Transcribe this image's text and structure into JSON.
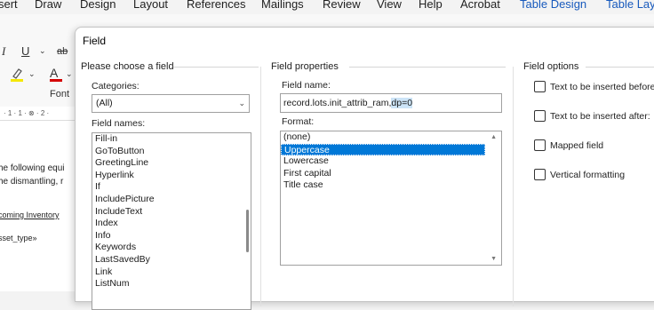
{
  "ribbon": {
    "tabs": [
      {
        "label": "sert",
        "accent": false
      },
      {
        "label": "Draw",
        "accent": false
      },
      {
        "label": "Design",
        "accent": false
      },
      {
        "label": "Layout",
        "accent": false
      },
      {
        "label": "References",
        "accent": false
      },
      {
        "label": "Mailings",
        "accent": false
      },
      {
        "label": "Review",
        "accent": false
      },
      {
        "label": "View",
        "accent": false
      },
      {
        "label": "Help",
        "accent": false
      },
      {
        "label": "Acrobat",
        "accent": false
      },
      {
        "label": "Table Design",
        "accent": true
      },
      {
        "label": "Table Lay",
        "accent": true
      }
    ],
    "font_group_label": "Font",
    "italic": "I",
    "underline": "U",
    "strike": "ab",
    "font_color_glyph": "A",
    "ruler_text": "· 1 · 1 · ⊗ · 2 ·"
  },
  "document": {
    "line1": "he following equi",
    "line2": "he dismantling, r",
    "heading": "coming Inventory",
    "merge_field": "sset_type»"
  },
  "dialog": {
    "title": "Field",
    "choose_panel": {
      "title": "Please choose a field",
      "categories_label": "Categories:",
      "category_value": "(All)",
      "field_names_label": "Field names:",
      "field_names": [
        "Fill-in",
        "GoToButton",
        "GreetingLine",
        "Hyperlink",
        "If",
        "IncludePicture",
        "IncludeText",
        "Index",
        "Info",
        "Keywords",
        "LastSavedBy",
        "Link",
        "ListNum"
      ]
    },
    "properties_panel": {
      "title": "Field properties",
      "field_name_label": "Field name:",
      "field_name_value_plain": "record.lots.init_attrib_ram,",
      "field_name_value_selected": "dp=0",
      "format_label": "Format:",
      "formats": [
        "(none)",
        "Uppercase",
        "Lowercase",
        "First capital",
        "Title case"
      ],
      "selected_format": "Uppercase"
    },
    "options_panel": {
      "title": "Field options",
      "options": [
        {
          "label": "Text to be inserted before",
          "checked": false
        },
        {
          "label": "Text to be inserted after:",
          "checked": false
        },
        {
          "label": "Mapped field",
          "checked": false
        },
        {
          "label": "Vertical formatting",
          "checked": false
        }
      ]
    }
  }
}
